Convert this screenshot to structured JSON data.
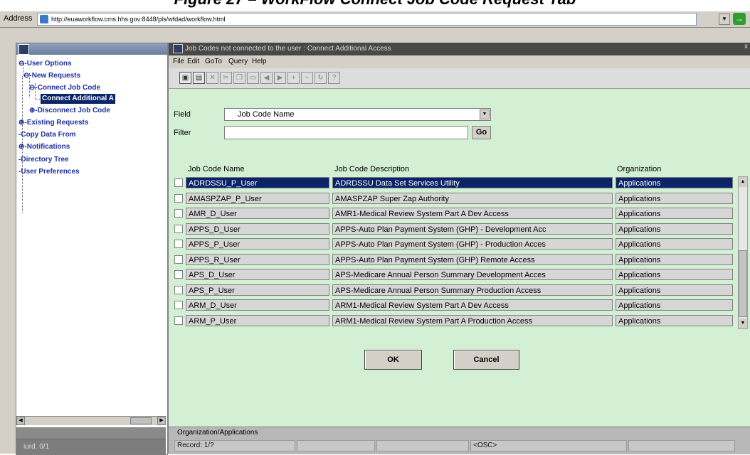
{
  "caption": "Figure 27 – WorkFlow Connect Job Code Request Tab",
  "browser": {
    "address_label": "Address",
    "url": "http://euaworkflow.cms.hhs.gov:8448/pls/wfdad/workflow.html"
  },
  "navigator": {
    "title": "",
    "tree": [
      {
        "label": "User Options",
        "prefix": "⊖-"
      },
      {
        "label": "New Requests",
        "prefix": "⊖-"
      },
      {
        "label": "Connect Job Code",
        "prefix": "⊖-"
      },
      {
        "label": "Connect Additional A",
        "prefix": ""
      },
      {
        "label": "Disconnect Job Code",
        "prefix": "⊕-"
      },
      {
        "label": "Existing Requests",
        "prefix": "⊕-"
      },
      {
        "label": "Copy Data From",
        "prefix": "-"
      },
      {
        "label": "Notifications",
        "prefix": "⊕-"
      },
      {
        "label": "Directory Tree",
        "prefix": "-"
      },
      {
        "label": "User Preferences",
        "prefix": "-"
      }
    ],
    "status_text": "iurd. 0/1"
  },
  "window": {
    "title": "Job Codes not connected to the user : Connect Additional Access",
    "close_glyph": "x",
    "menu": [
      "File",
      "Edit",
      "GoTo",
      "Query",
      "Help"
    ]
  },
  "form": {
    "field_label": "Field",
    "field_value": "Job Code Name",
    "filter_label": "Filter",
    "filter_value": "",
    "go_label": "Go",
    "columns": [
      "Job Code Name",
      "Job Code Description",
      "Organization"
    ],
    "rows": [
      {
        "name": "ADRDSSU_P_User",
        "desc": "ADRDSSU Data Set Services Utility",
        "org": "Applications",
        "selected": true
      },
      {
        "name": "AMASPZAP_P_User",
        "desc": "AMASPZAP Super Zap Authority",
        "org": "Applications"
      },
      {
        "name": "AMR_D_User",
        "desc": "AMR1-Medical Review System Part A Dev Access",
        "org": "Applications"
      },
      {
        "name": "APPS_D_User",
        "desc": "APPS-Auto Plan Payment System (GHP) - Development  Acc",
        "org": "Applications"
      },
      {
        "name": "APPS_P_User",
        "desc": "APPS-Auto Plan Payment System (GHP) - Production Acces",
        "org": "Applications"
      },
      {
        "name": "APPS_R_User",
        "desc": "APPS-Auto Plan Payment System (GHP) Remote Access",
        "org": "Applications"
      },
      {
        "name": "APS_D_User",
        "desc": "APS-Medicare Annual Person Summary Development Acces",
        "org": "Applications"
      },
      {
        "name": "APS_P_User",
        "desc": "APS-Medicare Annual Person Summary Production Access",
        "org": "Applications"
      },
      {
        "name": "ARM_D_User",
        "desc": "ARM1-Medical Review System Part A Dev Access",
        "org": "Applications"
      },
      {
        "name": "ARM_P_User",
        "desc": "ARM1-Medical Review System Part A Production Access",
        "org": "Applications"
      }
    ],
    "ok_label": "OK",
    "cancel_label": "Cancel"
  },
  "status": {
    "message": "Organization/Applications",
    "record": "Record: 1/?",
    "mode": "<OSC>"
  }
}
